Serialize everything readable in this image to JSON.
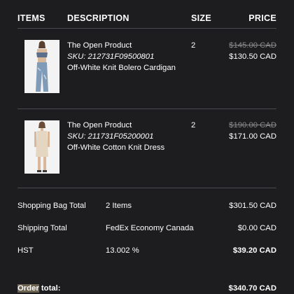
{
  "table": {
    "headers": {
      "items": "ITEMS",
      "description": "DESCRIPTION",
      "size": "SIZE",
      "price": "PRICE"
    }
  },
  "items": [
    {
      "brand": "The Open Product",
      "sku": "SKU: 212731F09500801",
      "name": "Off-White Knit Bolero Cardigan",
      "size": "2",
      "original_price": "$145.00 CAD",
      "sale_price": "$130.50 CAD"
    },
    {
      "brand": "The Open Product",
      "sku": "SKU: 211731F05200001",
      "name": "Off-White Cotton Knit Dress",
      "size": "2",
      "original_price": "$190.00 CAD",
      "sale_price": "$171.00 CAD"
    }
  ],
  "summary": {
    "bag": {
      "label": "Shopping Bag Total",
      "value": "2 Items",
      "amount": "$301.50 CAD"
    },
    "shipping": {
      "label": "Shipping Total",
      "value": "FedEx Economy Canada",
      "amount": "$0.00 CAD"
    },
    "tax": {
      "label": "HST",
      "value": "13.002 %",
      "amount": "$39.20 CAD"
    },
    "total": {
      "label_highlight": "Order",
      "label_rest": " total:",
      "amount": "$340.70 CAD"
    }
  },
  "colors": {
    "background": "#1d1d1f",
    "text": "#ffffff",
    "divider": "#4a4a4e",
    "strike": "#8a8a8a"
  }
}
